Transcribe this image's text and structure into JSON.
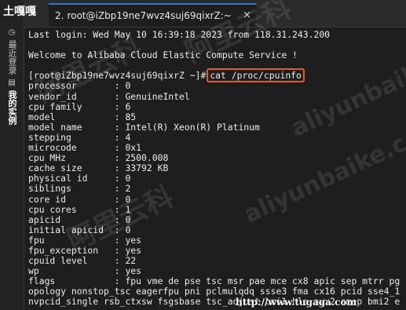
{
  "app": {
    "logo_text": "土嘎嘎"
  },
  "sidebar": {
    "items": [
      {
        "label": "最近登录",
        "icon": "clock-icon"
      },
      {
        "label": "我的实例",
        "icon": "server-icon"
      }
    ]
  },
  "tab": {
    "number": "2.",
    "title": "root@iZbp19ne7wvz4suj69qixrZ:~",
    "close": "×"
  },
  "terminal": {
    "lines": [
      "Last login: Wed May 10 16:39:18 2023 from 118.31.243.200",
      "",
      "Welcome to Alibaba Cloud Elastic Compute Service !",
      "",
      "PROMPT",
      "processor       : 0",
      "vendor_id       : GenuineIntel",
      "cpu family      : 6",
      "model           : 85",
      "model name      : Intel(R) Xeon(R) Platinum",
      "stepping        : 4",
      "microcode       : 0x1",
      "cpu MHz         : 2500.008",
      "cache size      : 33792 KB",
      "physical id     : 0",
      "siblings        : 2",
      "core id         : 0",
      "cpu cores       : 1",
      "apicid          : 0",
      "initial apicid  : 0",
      "fpu             : yes",
      "fpu_exception   : yes",
      "cpuid level     : 22",
      "wp              : yes",
      "flags           : fpu vme de pse tsc msr pae mce cx8 apic sep mtrr pg",
      "opology nonstop_tsc eagerfpu pni pclmulqdq ssse3 fma cx16 pcid sse4_1",
      "nvpcid_single rsb_ctxsw fsgsbase tsc_adjust bmi1 hle avx2 smep bmi2 e"
    ],
    "prompt": "[root@iZbp19ne7wvz4suj69qixrZ ~]#",
    "command": "cat /proc/cpuinfo",
    "highlight_color": "#e65b2a"
  },
  "watermarks": {
    "text_cn": "阿里云科",
    "text_en": "aliyunbaike.com",
    "url": "http://www.tugaga.com"
  }
}
